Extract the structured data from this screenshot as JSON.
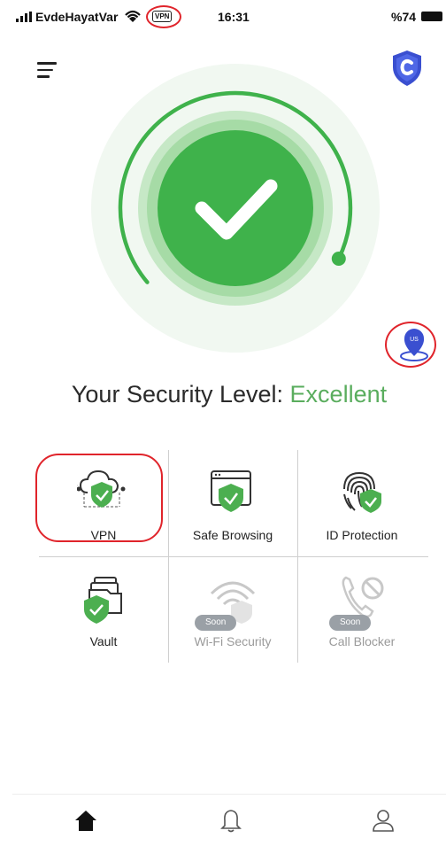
{
  "status_bar": {
    "carrier": "EvdeHayatVar",
    "vpn_badge": "VPN",
    "time": "16:31",
    "battery": "%74"
  },
  "header": {
    "menu_icon": "hamburger-menu-icon",
    "brand_icon": "shield-c-logo-icon"
  },
  "gauge": {
    "status_icon": "checkmark-icon",
    "level_fraction": 0.82,
    "location_label": "US"
  },
  "security": {
    "label": "Your Security Level:",
    "value": "Excellent"
  },
  "features": [
    {
      "label": "VPN",
      "icon": "cloud-shield-icon",
      "soon": ""
    },
    {
      "label": "Safe Browsing",
      "icon": "browser-shield-icon",
      "soon": ""
    },
    {
      "label": "ID Protection",
      "icon": "fingerprint-shield-icon",
      "soon": ""
    },
    {
      "label": "Vault",
      "icon": "folder-shield-icon",
      "soon": ""
    },
    {
      "label": "Wi-Fi Security",
      "icon": "wifi-shield-icon",
      "soon": "Soon"
    },
    {
      "label": "Call Blocker",
      "icon": "phone-block-icon",
      "soon": "Soon"
    }
  ],
  "nav": {
    "items": [
      "home-icon",
      "bell-icon",
      "profile-icon"
    ]
  },
  "colors": {
    "accent_green": "#5aad5e",
    "shield_green": "#4caf50",
    "brand_blue": "#3a4fd0",
    "annotation_red": "#e0242b"
  }
}
